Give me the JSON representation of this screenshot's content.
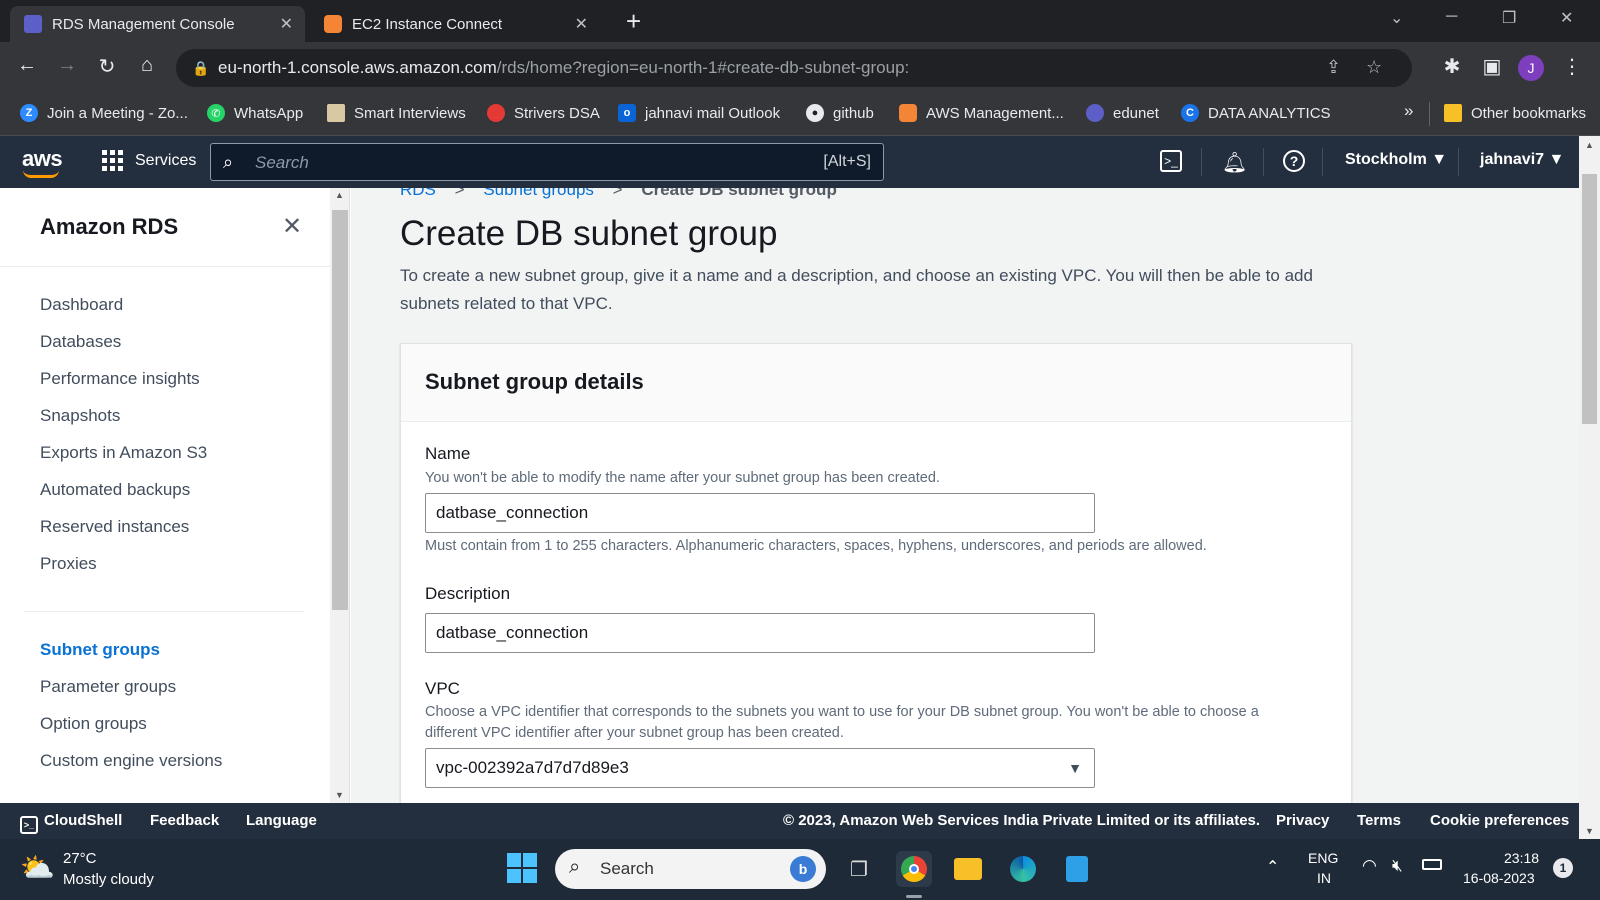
{
  "browser": {
    "tabs": [
      {
        "title": "RDS Management Console",
        "active": true
      },
      {
        "title": "EC2 Instance Connect",
        "active": false
      }
    ],
    "new_tab_label": "+",
    "url_host": "eu-north-1.console.aws.amazon.com",
    "url_path": "/rds/home?region=eu-north-1#create-db-subnet-group:",
    "profile_initial": "J",
    "bookmarks": [
      {
        "label": "Join a Meeting - Zo...",
        "icon": "zoom-icon",
        "color": "#2d8cff"
      },
      {
        "label": "WhatsApp",
        "icon": "whatsapp-icon",
        "color": "#25d366"
      },
      {
        "label": "Smart Interviews",
        "icon": "smart-interviews-icon",
        "color": "#d9c9a3"
      },
      {
        "label": "Strivers DSA",
        "icon": "tuf-icon",
        "color": "#e53935"
      },
      {
        "label": "jahnavi mail Outlook",
        "icon": "outlook-icon",
        "color": "#0a64d6"
      },
      {
        "label": "github",
        "icon": "github-icon",
        "color": "#e8eaed"
      },
      {
        "label": "AWS Management...",
        "icon": "aws-cube-icon",
        "color": "#f58536"
      },
      {
        "label": "edunet",
        "icon": "edunet-icon",
        "color": "#5b5fc7"
      },
      {
        "label": "DATA ANALYTICS",
        "icon": "c-icon",
        "color": "#1a73e8"
      }
    ],
    "more_bookmarks": "»",
    "other_bookmarks": "Other bookmarks"
  },
  "aws_nav": {
    "logo": "aws",
    "services_label": "Services",
    "search_placeholder": "Search",
    "search_shortcut": "[Alt+S]",
    "region": "Stockholm",
    "user": "jahnavi7"
  },
  "sidebar": {
    "title": "Amazon RDS",
    "items": [
      {
        "label": "Dashboard",
        "active": false
      },
      {
        "label": "Databases",
        "active": false
      },
      {
        "label": "Performance insights",
        "active": false
      },
      {
        "label": "Snapshots",
        "active": false
      },
      {
        "label": "Exports in Amazon S3",
        "active": false
      },
      {
        "label": "Automated backups",
        "active": false
      },
      {
        "label": "Reserved instances",
        "active": false
      },
      {
        "label": "Proxies",
        "active": false
      }
    ],
    "items2": [
      {
        "label": "Subnet groups",
        "active": true
      },
      {
        "label": "Parameter groups",
        "active": false
      },
      {
        "label": "Option groups",
        "active": false
      },
      {
        "label": "Custom engine versions",
        "active": false
      }
    ]
  },
  "breadcrumb": {
    "items": [
      "RDS",
      "Subnet groups",
      "Create DB subnet group"
    ],
    "separator": ">"
  },
  "page": {
    "title": "Create DB subnet group",
    "description": "To create a new subnet group, give it a name and a description, and choose an existing VPC. You will then be able to add subnets related to that VPC."
  },
  "panel": {
    "title": "Subnet group details",
    "name_label": "Name",
    "name_help": "You won't be able to modify the name after your subnet group has been created.",
    "name_value": "datbase_connection",
    "name_constraint": "Must contain from 1 to 255 characters. Alphanumeric characters, spaces, hyphens, underscores, and periods are allowed.",
    "description_label": "Description",
    "description_value": "datbase_connection",
    "vpc_label": "VPC",
    "vpc_help": "Choose a VPC identifier that corresponds to the subnets you want to use for your DB subnet group. You won't be able to choose a different VPC identifier after your subnet group has been created.",
    "vpc_value": "vpc-002392a7d7d7d89e3"
  },
  "footer": {
    "cloudshell": "CloudShell",
    "feedback": "Feedback",
    "language": "Language",
    "copyright": "© 2023, Amazon Web Services India Private Limited or its affiliates.",
    "privacy": "Privacy",
    "terms": "Terms",
    "cookies": "Cookie preferences"
  },
  "taskbar": {
    "temperature": "27°C",
    "weather": "Mostly cloudy",
    "search_placeholder": "Search",
    "lang_line1": "ENG",
    "lang_line2": "IN",
    "time": "23:18",
    "date": "16-08-2023",
    "notification_count": "1"
  },
  "colors": {
    "aws_nav_bg": "#232f3e",
    "aws_orange": "#ff9900",
    "link_blue": "#0972d3",
    "chrome_dark": "#202124"
  }
}
